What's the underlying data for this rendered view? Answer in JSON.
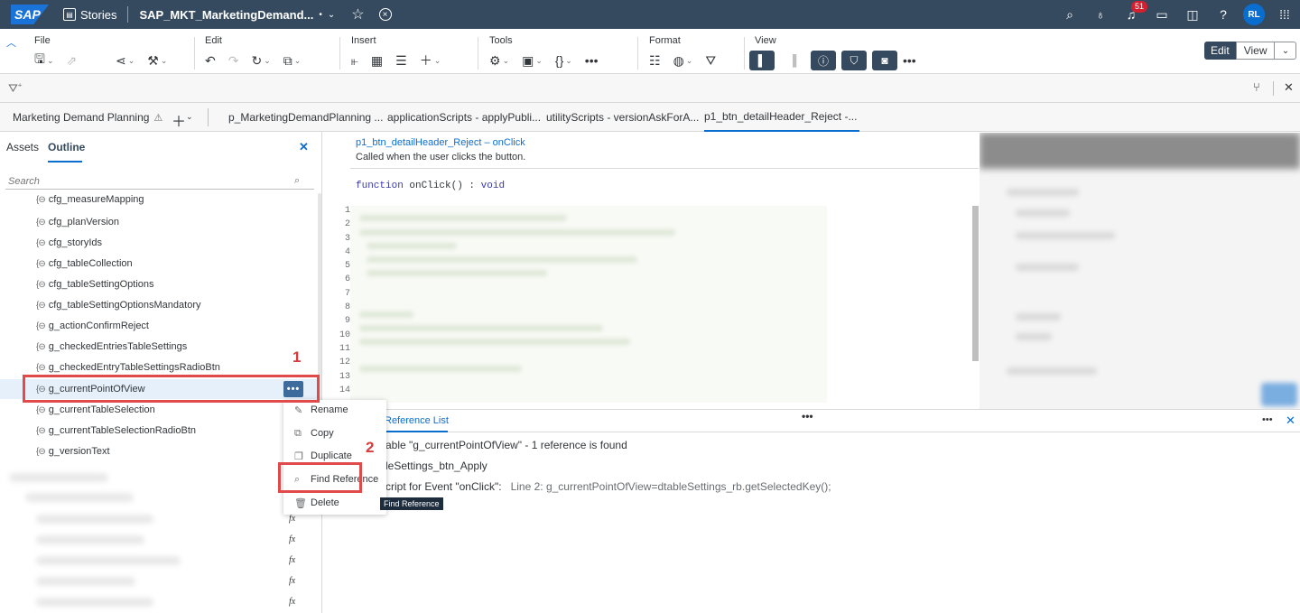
{
  "shell": {
    "logo": "SAP",
    "stories": "Stories",
    "title": "SAP_MKT_MarketingDemand...",
    "unsaved_dot": "•",
    "notifications_count": "51",
    "avatar_initials": "RL"
  },
  "toolbar": {
    "groups": {
      "file": "File",
      "edit": "Edit",
      "insert": "Insert",
      "tools": "Tools",
      "format": "Format",
      "view": "View"
    },
    "mode_edit": "Edit",
    "mode_view": "View"
  },
  "tabs": [
    {
      "label": "Marketing Demand Planning",
      "active": false
    },
    {
      "label": "p_MarketingDemandPlanning ...",
      "active": false
    },
    {
      "label": "applicationScripts - applyPubli...",
      "active": false
    },
    {
      "label": "utilityScripts - versionAskForA...",
      "active": false
    },
    {
      "label": "p1_btn_detailHeader_Reject -...",
      "active": true
    }
  ],
  "left_panel": {
    "tabs": [
      "Assets",
      "Outline"
    ],
    "search_placeholder": "Search",
    "items": [
      "cfg_measureMapping",
      "cfg_planVersion",
      "cfg_storyIds",
      "cfg_tableCollection",
      "cfg_tableSettingOptions",
      "cfg_tableSettingOptionsMandatory",
      "g_actionConfirmReject",
      "g_checkedEntriesTableSettings",
      "g_checkedEntryTableSettingsRadioBtn",
      "g_currentPointOfView",
      "g_currentTableSelection",
      "g_currentTableSelectionRadioBtn",
      "g_versionText"
    ],
    "selected": "g_currentPointOfView",
    "fx_label": "fx"
  },
  "context_menu": {
    "items": [
      "Rename",
      "Copy",
      "Duplicate",
      "Find Reference",
      "Delete"
    ],
    "tooltip": "Find Reference"
  },
  "annotations": [
    "1",
    "2"
  ],
  "editor": {
    "title": "p1_btn_detailHeader_Reject – onClick",
    "description": "Called when the user clicks the button.",
    "signature_kw1": "function",
    "signature_name": "onClick() :",
    "signature_kw2": "void",
    "line_numbers": [
      "1",
      "2",
      "3",
      "4",
      "5",
      "6",
      "7",
      "8",
      "9",
      "10",
      "11",
      "12",
      "13",
      "14"
    ]
  },
  "reference_list": {
    "tab": "Reference List",
    "summary": "able \"g_currentPointOfView\" - 1 reference is found",
    "widget": "leSettings_btn_Apply",
    "event_label": "cript for Event \"onClick\":",
    "event_detail": "Line 2: g_currentPointOfView=dtableSettings_rb.getSelectedKey();"
  }
}
